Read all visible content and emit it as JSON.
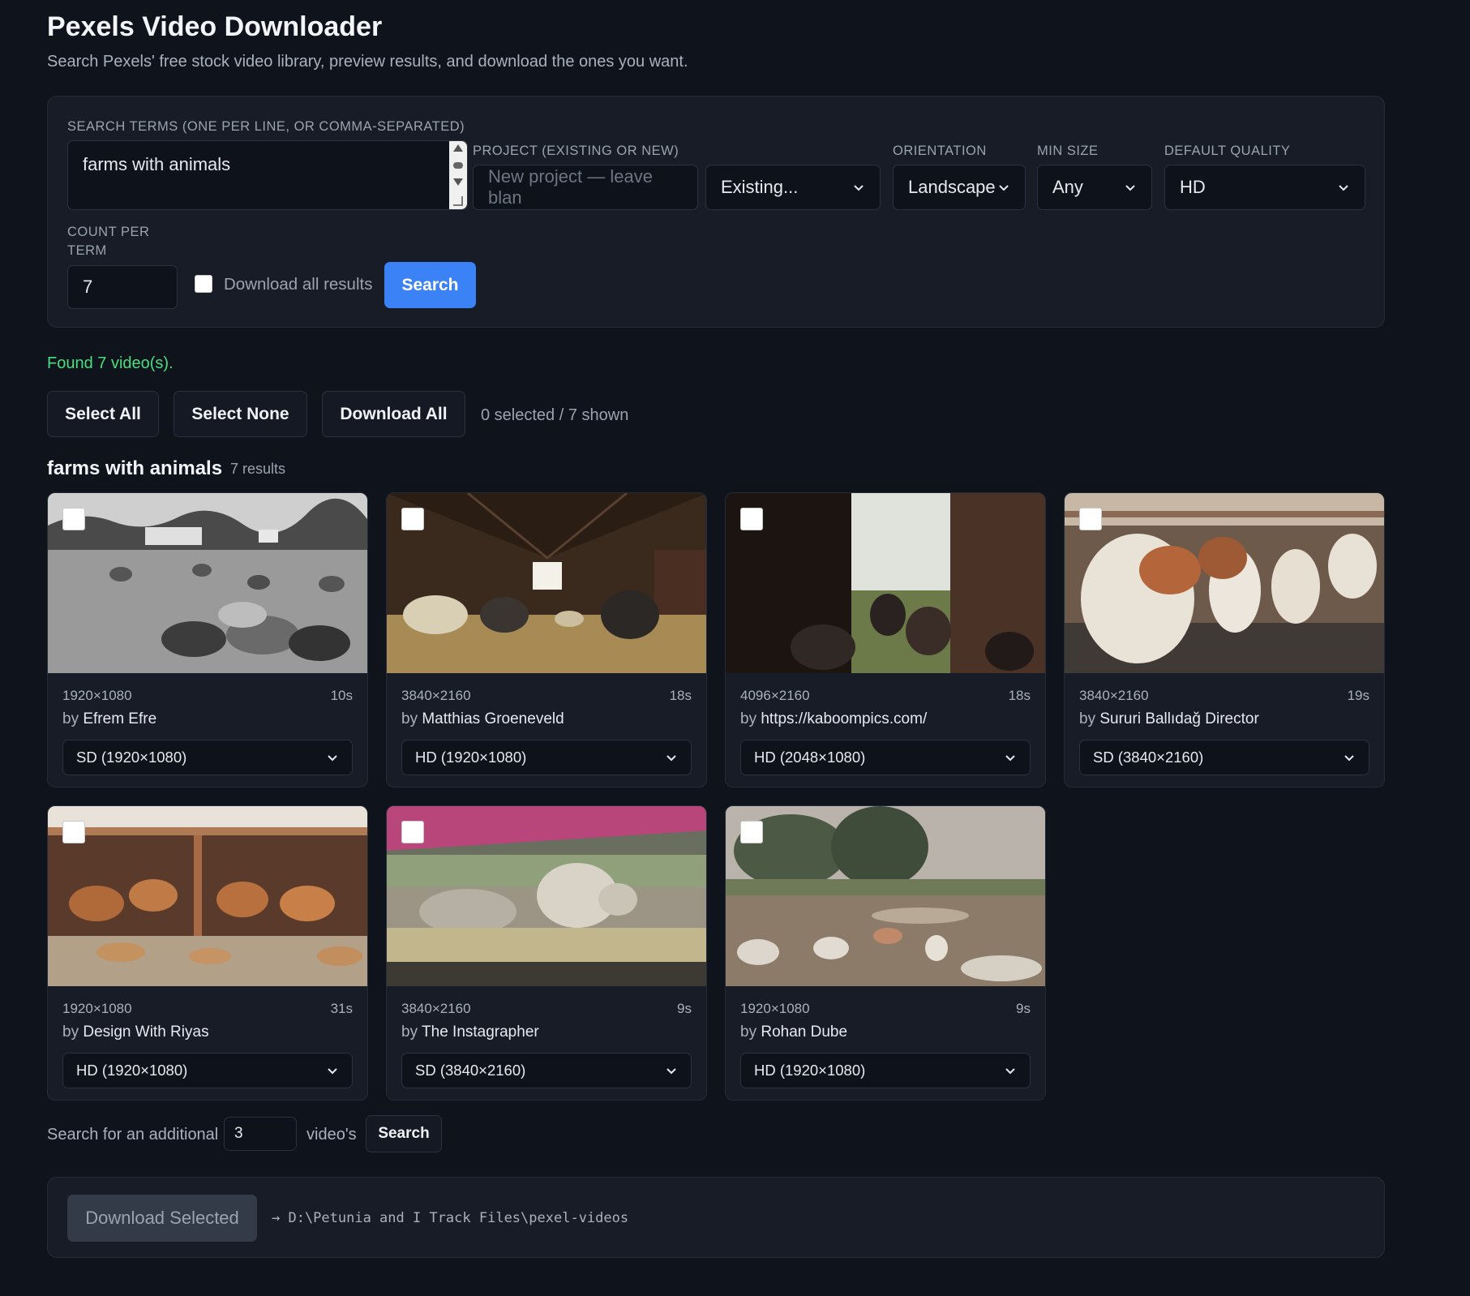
{
  "header": {
    "title": "Pexels Video Downloader",
    "subtitle": "Search Pexels' free stock video library, preview results, and download the ones you want."
  },
  "form": {
    "search_terms_label": "SEARCH TERMS (ONE PER LINE, OR COMMA-SEPARATED)",
    "search_terms_value": "farms with animals",
    "project_label": "PROJECT (EXISTING OR NEW)",
    "project_placeholder": "New project — leave blan",
    "project_select": "Existing...",
    "orientation_label": "ORIENTATION",
    "orientation_value": "Landscape",
    "min_size_label": "MIN SIZE",
    "min_size_value": "Any",
    "default_quality_label": "DEFAULT QUALITY",
    "default_quality_value": "HD",
    "count_label_line1": "COUNT PER",
    "count_label_line2": "TERM",
    "count_value": "7",
    "download_all_label": "Download all results",
    "search_button": "Search"
  },
  "status": {
    "found_text": "Found 7 video(s).",
    "select_all": "Select All",
    "select_none": "Select None",
    "download_all": "Download All",
    "selection_count": "0 selected / 7 shown"
  },
  "group": {
    "title": "farms with animals",
    "count": "7 results"
  },
  "videos": [
    {
      "resolution": "1920×1080",
      "duration": "10s",
      "by": "by",
      "author": "Efrem Efre",
      "quality": "SD (1920×1080)"
    },
    {
      "resolution": "3840×2160",
      "duration": "18s",
      "by": "by",
      "author": "Matthias Groeneveld",
      "quality": "HD (1920×1080)"
    },
    {
      "resolution": "4096×2160",
      "duration": "18s",
      "by": "by",
      "author": "https://kaboompics.com/",
      "quality": "HD (2048×1080)"
    },
    {
      "resolution": "3840×2160",
      "duration": "19s",
      "by": "by",
      "author": "Sururi Ballıdağ Director",
      "quality": "SD (3840×2160)"
    },
    {
      "resolution": "1920×1080",
      "duration": "31s",
      "by": "by",
      "author": "Design With Riyas",
      "quality": "HD (1920×1080)"
    },
    {
      "resolution": "3840×2160",
      "duration": "9s",
      "by": "by",
      "author": "The Instagrapher",
      "quality": "SD (3840×2160)"
    },
    {
      "resolution": "1920×1080",
      "duration": "9s",
      "by": "by",
      "author": "Rohan Dube",
      "quality": "HD (1920×1080)"
    }
  ],
  "additional": {
    "prefix": "Search for an additional",
    "value": "3",
    "suffix": "video's",
    "button": "Search"
  },
  "footer": {
    "download_selected": "Download Selected",
    "path": "→ D:\\Petunia and I Track Files\\pexel-videos"
  },
  "icons": {
    "chevron": "chevron-down-icon",
    "checkbox": "checkbox-icon"
  }
}
